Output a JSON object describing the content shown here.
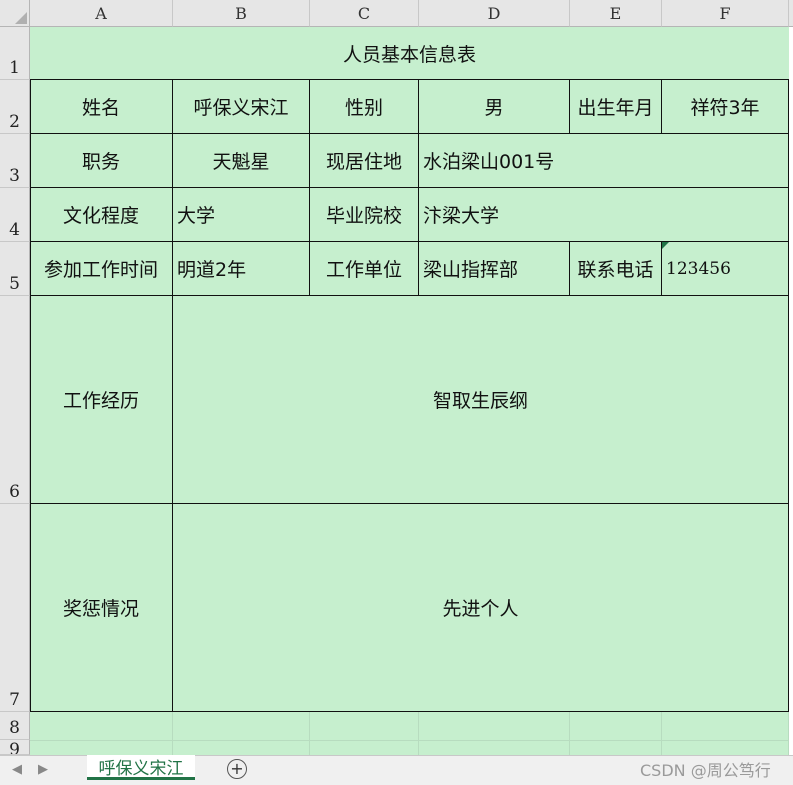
{
  "columns": [
    "A",
    "B",
    "C",
    "D",
    "E",
    "F"
  ],
  "rows": [
    "1",
    "2",
    "3",
    "4",
    "5",
    "6",
    "7",
    "8",
    "9"
  ],
  "sheet": {
    "title": "人员基本信息表",
    "r2": {
      "name_label": "姓名",
      "name": "呼保义宋江",
      "gender_label": "性别",
      "gender": "男",
      "birth_label": "出生年月",
      "birth": "祥符3年"
    },
    "r3": {
      "post_label": "职务",
      "post": "天魁星",
      "address_label": "现居住地",
      "address": "水泊梁山001号"
    },
    "r4": {
      "edu_label": "文化程度",
      "edu": "大学",
      "school_label": "毕业院校",
      "school": "汴梁大学"
    },
    "r5": {
      "start_label": "参加工作时间",
      "start": "明道2年",
      "employer_label": "工作单位",
      "employer": "梁山指挥部",
      "phone_label": "联系电话",
      "phone": "123456"
    },
    "r6": {
      "history_label": "工作经历",
      "history": "智取生辰纲"
    },
    "r7": {
      "awards_label": "奖惩情况",
      "awards": "先进个人"
    }
  },
  "tabs": {
    "nav_prev": "◀",
    "nav_next": "▶",
    "active_sheet": "呼保义宋江",
    "add": "+"
  },
  "watermark": "CSDN @周公笃行",
  "colors": {
    "cell_fill": "#c6efce",
    "accent": "#217346",
    "header_bg": "#e6e6e6"
  }
}
